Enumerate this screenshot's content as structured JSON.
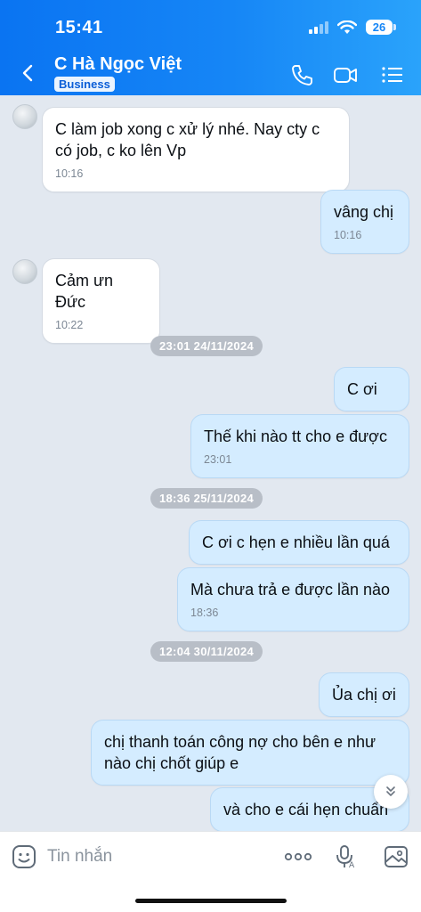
{
  "status_bar": {
    "time": "15:41",
    "battery": "26",
    "icons": [
      "signal-icon",
      "wifi-icon",
      "battery-icon"
    ]
  },
  "header": {
    "title": "C Hà Ngọc Việt",
    "badge": "Business",
    "icons": [
      "back-icon",
      "phone-icon",
      "video-icon",
      "menu-icon"
    ]
  },
  "messages": [
    {
      "sender": "them",
      "text": "C làm job xong c xử lý nhé. Nay cty c có job, c ko lên Vp",
      "time": "10:16"
    },
    {
      "sender": "me",
      "text": "vâng chị",
      "time": "10:16"
    },
    {
      "sender": "them",
      "text": "Cảm ưn Đức",
      "time": "10:22"
    },
    {
      "date": "23:01 24/11/2024"
    },
    {
      "sender": "me",
      "text": "C ơi",
      "time": ""
    },
    {
      "sender": "me",
      "text": "Thế khi nào tt cho e được",
      "time": "23:01"
    },
    {
      "date": "18:36 25/11/2024"
    },
    {
      "sender": "me",
      "text": "C ơi c hẹn e nhiều lần quá",
      "time": ""
    },
    {
      "sender": "me",
      "text": "Mà chưa trả e được lần nào",
      "time": "18:36"
    },
    {
      "date": "12:04 30/11/2024"
    },
    {
      "sender": "me",
      "text": "Ủa chị ơi",
      "time": ""
    },
    {
      "sender": "me",
      "text": "chị thanh toán công nợ cho bên e như nào chị chốt giúp e",
      "time": ""
    },
    {
      "sender": "me",
      "text": "và cho e cái hẹn chuẩn",
      "time": ""
    }
  ],
  "input_bar": {
    "placeholder": "Tin nhắn",
    "icons": [
      "sticker-icon",
      "more-icon",
      "voice-icon",
      "image-icon"
    ]
  },
  "colors": {
    "header": "#1686f6",
    "my_bubble": "#d4ecff",
    "their_bubble": "#ffffff",
    "chat_bg": "#e2e8f0",
    "date_pill": "#b8bec7"
  }
}
